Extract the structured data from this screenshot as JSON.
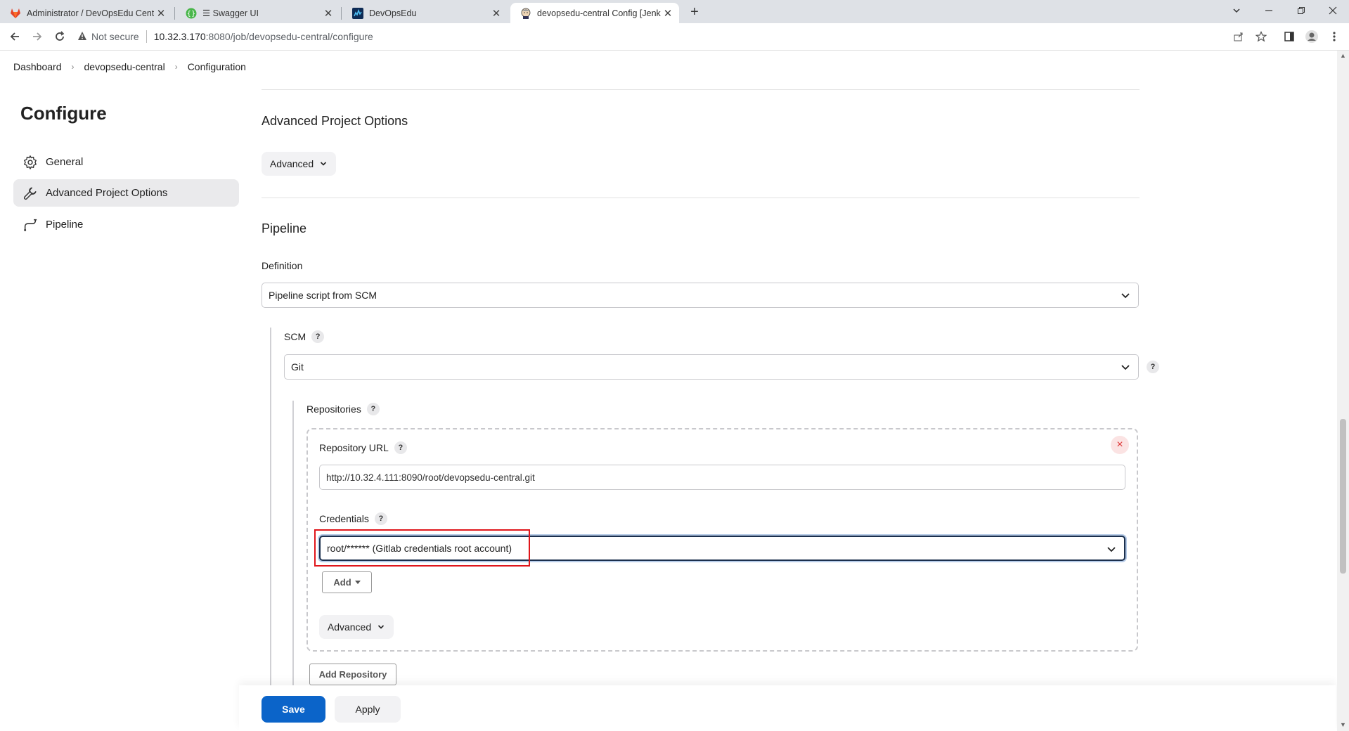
{
  "browser": {
    "tabs": [
      {
        "title": "Administrator / DevOpsEdu Central",
        "icon": "gitlab-icon"
      },
      {
        "title": "☰ Swagger UI",
        "icon": "swagger-icon"
      },
      {
        "title": "DevOpsEdu",
        "icon": "devopsedu-icon"
      },
      {
        "title": "devopsedu-central Config [Jenkins]",
        "icon": "jenkins-icon"
      }
    ],
    "security_label": "Not secure",
    "url_host": "10.32.3.170",
    "url_path": ":8080/job/devopsedu-central/configure",
    "colors": {
      "tabbar": "#dee1e6",
      "active_tab": "#ffffff"
    }
  },
  "breadcrumbs": [
    "Dashboard",
    "devopsedu-central",
    "Configuration"
  ],
  "sidebar": {
    "title": "Configure",
    "items": [
      {
        "label": "General",
        "icon": "gear-icon"
      },
      {
        "label": "Advanced Project Options",
        "icon": "wrench-icon",
        "active": true
      },
      {
        "label": "Pipeline",
        "icon": "pipeline-icon"
      }
    ]
  },
  "main": {
    "advanced_project_options": {
      "title": "Advanced Project Options",
      "advanced_button": "Advanced"
    },
    "pipeline": {
      "title": "Pipeline",
      "definition_label": "Definition",
      "definition_value": "Pipeline script from SCM",
      "scm_label": "SCM",
      "scm_value": "Git",
      "repositories_label": "Repositories",
      "repository_url_label": "Repository URL",
      "repository_url_value": "http://10.32.4.111:8090/root/devopsedu-central.git",
      "credentials_label": "Credentials",
      "credentials_value": "root/****** (Gitlab credentials root account)",
      "add_button": "Add",
      "advanced_button": "Advanced",
      "add_repository_button": "Add Repository",
      "help_glyph": "?",
      "delete_glyph": "×"
    }
  },
  "footer": {
    "save": "Save",
    "apply": "Apply"
  },
  "colors": {
    "primary": "#0b64c9",
    "highlight": "#e0161b",
    "active_sidebar": "#eaeaec"
  }
}
